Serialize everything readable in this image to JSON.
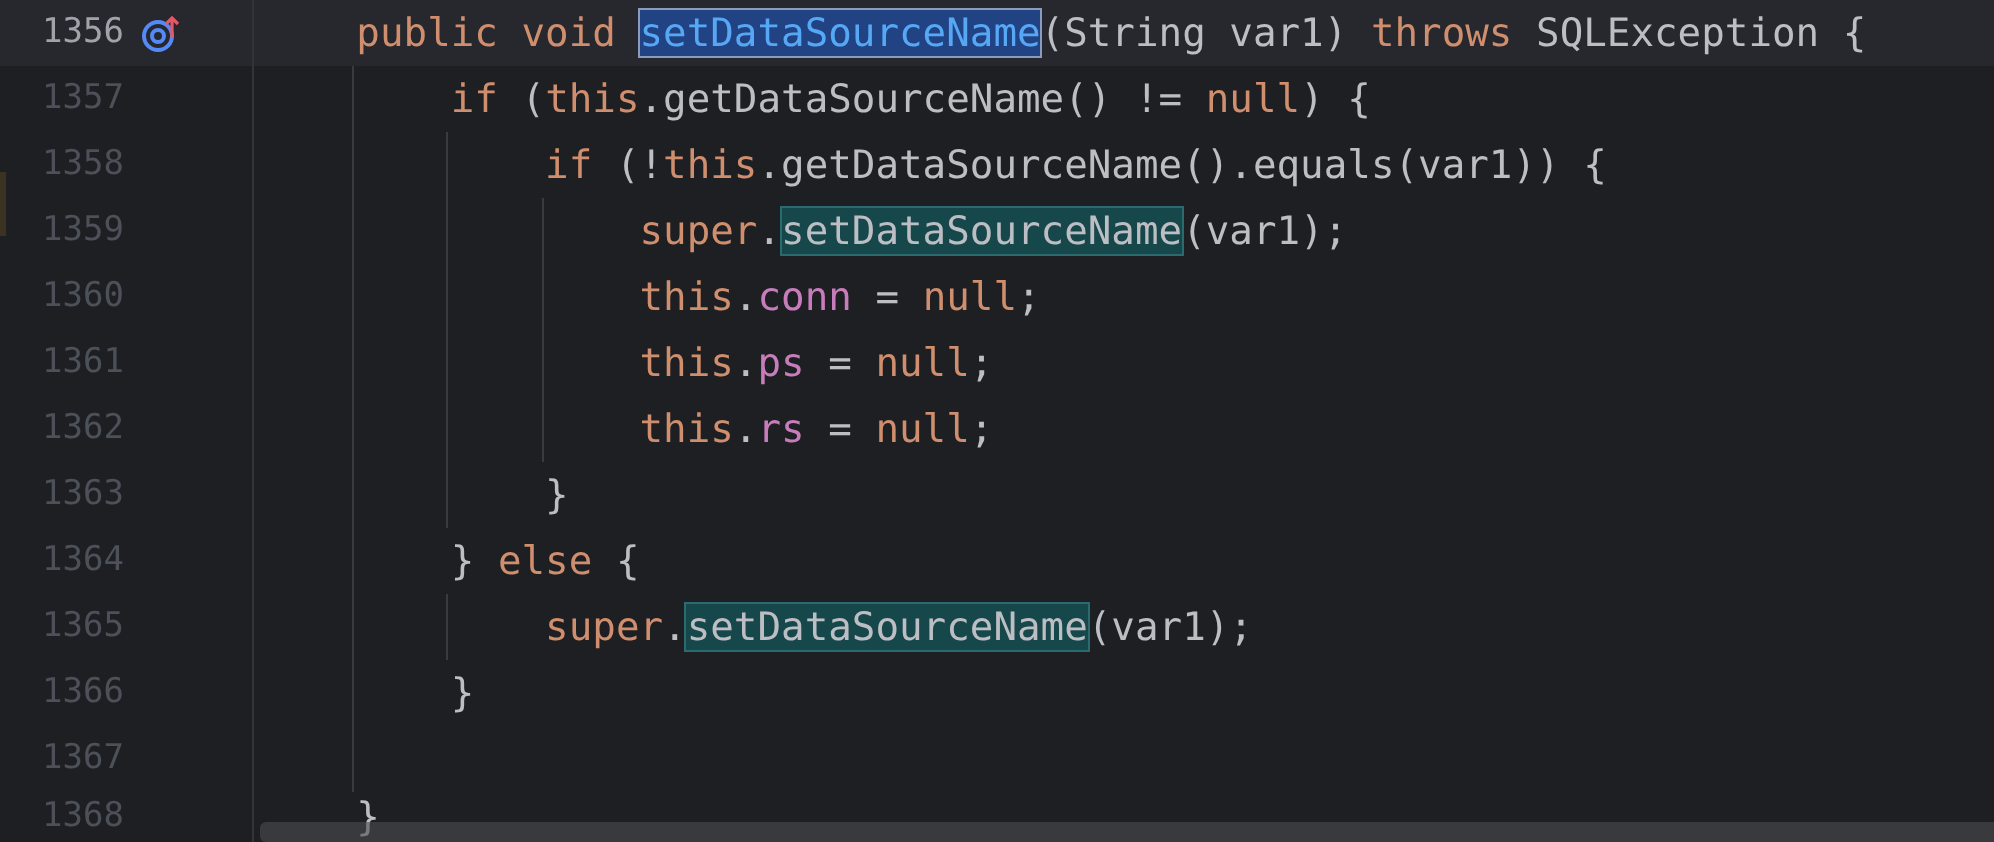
{
  "editor": {
    "lines": [
      {
        "number": "1356",
        "current": true,
        "override_marker": true,
        "tokens": [
          {
            "text": "    public void ",
            "kind": "keyword"
          },
          {
            "text": "setDataSourceName",
            "kind": "selected"
          },
          {
            "text": "(String var1) ",
            "kind": "plain"
          },
          {
            "text": "throws ",
            "kind": "keyword"
          },
          {
            "text": "SQLException {",
            "kind": "plain"
          }
        ]
      },
      {
        "number": "1357",
        "current": false,
        "tokens": [
          {
            "text": "        if ",
            "kind": "keyword"
          },
          {
            "text": "(",
            "kind": "plain"
          },
          {
            "text": "this",
            "kind": "keyword"
          },
          {
            "text": ".getDataSourceName() != ",
            "kind": "plain"
          },
          {
            "text": "null",
            "kind": "keyword"
          },
          {
            "text": ") {",
            "kind": "plain"
          }
        ]
      },
      {
        "number": "1358",
        "current": false,
        "tokens": [
          {
            "text": "            if ",
            "kind": "keyword"
          },
          {
            "text": "(!",
            "kind": "plain"
          },
          {
            "text": "this",
            "kind": "keyword"
          },
          {
            "text": ".getDataSourceName().equals(var1)) {",
            "kind": "plain"
          }
        ]
      },
      {
        "number": "1359",
        "current": false,
        "tokens": [
          {
            "text": "                super",
            "kind": "keyword"
          },
          {
            "text": ".",
            "kind": "plain"
          },
          {
            "text": "setDataSourceName",
            "kind": "usage"
          },
          {
            "text": "(var1);",
            "kind": "plain"
          }
        ]
      },
      {
        "number": "1360",
        "current": false,
        "tokens": [
          {
            "text": "                this",
            "kind": "keyword"
          },
          {
            "text": ".",
            "kind": "plain"
          },
          {
            "text": "conn",
            "kind": "field"
          },
          {
            "text": " = ",
            "kind": "plain"
          },
          {
            "text": "null",
            "kind": "keyword"
          },
          {
            "text": ";",
            "kind": "plain"
          }
        ]
      },
      {
        "number": "1361",
        "current": false,
        "tokens": [
          {
            "text": "                this",
            "kind": "keyword"
          },
          {
            "text": ".",
            "kind": "plain"
          },
          {
            "text": "ps",
            "kind": "field"
          },
          {
            "text": " = ",
            "kind": "plain"
          },
          {
            "text": "null",
            "kind": "keyword"
          },
          {
            "text": ";",
            "kind": "plain"
          }
        ]
      },
      {
        "number": "1362",
        "current": false,
        "tokens": [
          {
            "text": "                this",
            "kind": "keyword"
          },
          {
            "text": ".",
            "kind": "plain"
          },
          {
            "text": "rs",
            "kind": "field"
          },
          {
            "text": " = ",
            "kind": "plain"
          },
          {
            "text": "null",
            "kind": "keyword"
          },
          {
            "text": ";",
            "kind": "plain"
          }
        ]
      },
      {
        "number": "1363",
        "current": false,
        "tokens": [
          {
            "text": "            }",
            "kind": "plain"
          }
        ]
      },
      {
        "number": "1364",
        "current": false,
        "tokens": [
          {
            "text": "        } ",
            "kind": "plain"
          },
          {
            "text": "else ",
            "kind": "keyword"
          },
          {
            "text": "{",
            "kind": "plain"
          }
        ]
      },
      {
        "number": "1365",
        "current": false,
        "tokens": [
          {
            "text": "            super",
            "kind": "keyword"
          },
          {
            "text": ".",
            "kind": "plain"
          },
          {
            "text": "setDataSourceName",
            "kind": "usage"
          },
          {
            "text": "(var1);",
            "kind": "plain"
          }
        ]
      },
      {
        "number": "1366",
        "current": false,
        "tokens": [
          {
            "text": "        }",
            "kind": "plain"
          }
        ]
      },
      {
        "number": "1367",
        "current": false
      },
      {
        "number": "1368",
        "current": false,
        "tokens": [
          {
            "text": "    }",
            "kind": "plain"
          }
        ]
      }
    ]
  }
}
